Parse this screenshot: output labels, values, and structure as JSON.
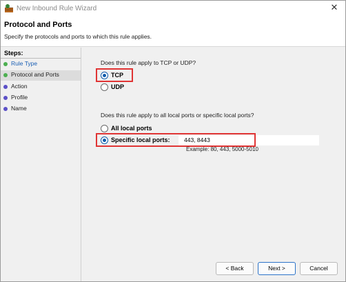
{
  "window": {
    "title": "New Inbound Rule Wizard"
  },
  "header": {
    "title": "Protocol and Ports",
    "subtitle": "Specify the protocols and ports to which this rule applies."
  },
  "steps": {
    "title": "Steps:",
    "items": [
      {
        "label": "Rule Type",
        "dot_color": "#4caf50"
      },
      {
        "label": "Protocol and Ports",
        "dot_color": "#4caf50"
      },
      {
        "label": "Action",
        "dot_color": "#5b4fc7"
      },
      {
        "label": "Profile",
        "dot_color": "#5b4fc7"
      },
      {
        "label": "Name",
        "dot_color": "#5b4fc7"
      }
    ]
  },
  "protocol": {
    "question": "Does this rule apply to TCP or UDP?",
    "options": [
      {
        "label": "TCP",
        "selected": true
      },
      {
        "label": "UDP",
        "selected": false
      }
    ]
  },
  "ports": {
    "question": "Does this rule apply to all local ports or specific local ports?",
    "options": [
      {
        "label": "All local ports",
        "selected": false
      },
      {
        "label": "Specific local ports:",
        "selected": true
      }
    ],
    "value": "443, 8443",
    "example": "Example: 80, 443, 5000-5010"
  },
  "buttons": {
    "back": "< Back",
    "next": "Next >",
    "cancel": "Cancel"
  },
  "colors": {
    "highlight": "#e03434",
    "accent": "#0b5cab",
    "link": "#1a5fb4"
  },
  "icons": {
    "app": "firewall-shield-icon",
    "close": "close-icon"
  }
}
